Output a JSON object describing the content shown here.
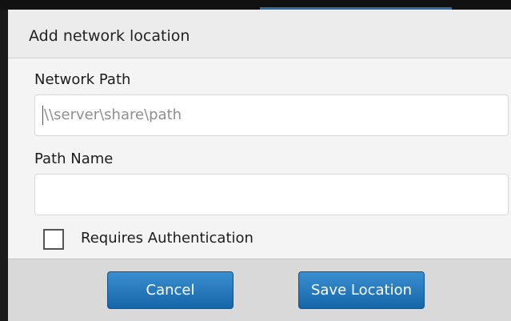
{
  "dialog": {
    "title": "Add network location",
    "network_path": {
      "label": "Network Path",
      "placeholder": "\\\\server\\share\\path",
      "value": ""
    },
    "path_name": {
      "label": "Path Name",
      "placeholder": "",
      "value": ""
    },
    "requires_authentication": {
      "label": "Requires Authentication",
      "checked": false
    },
    "buttons": {
      "cancel": "Cancel",
      "save": "Save Location"
    }
  },
  "colors": {
    "button_primary": "#1f74b8",
    "dialog_background": "#f4f4f4",
    "footer_background": "#d9d9d9"
  }
}
